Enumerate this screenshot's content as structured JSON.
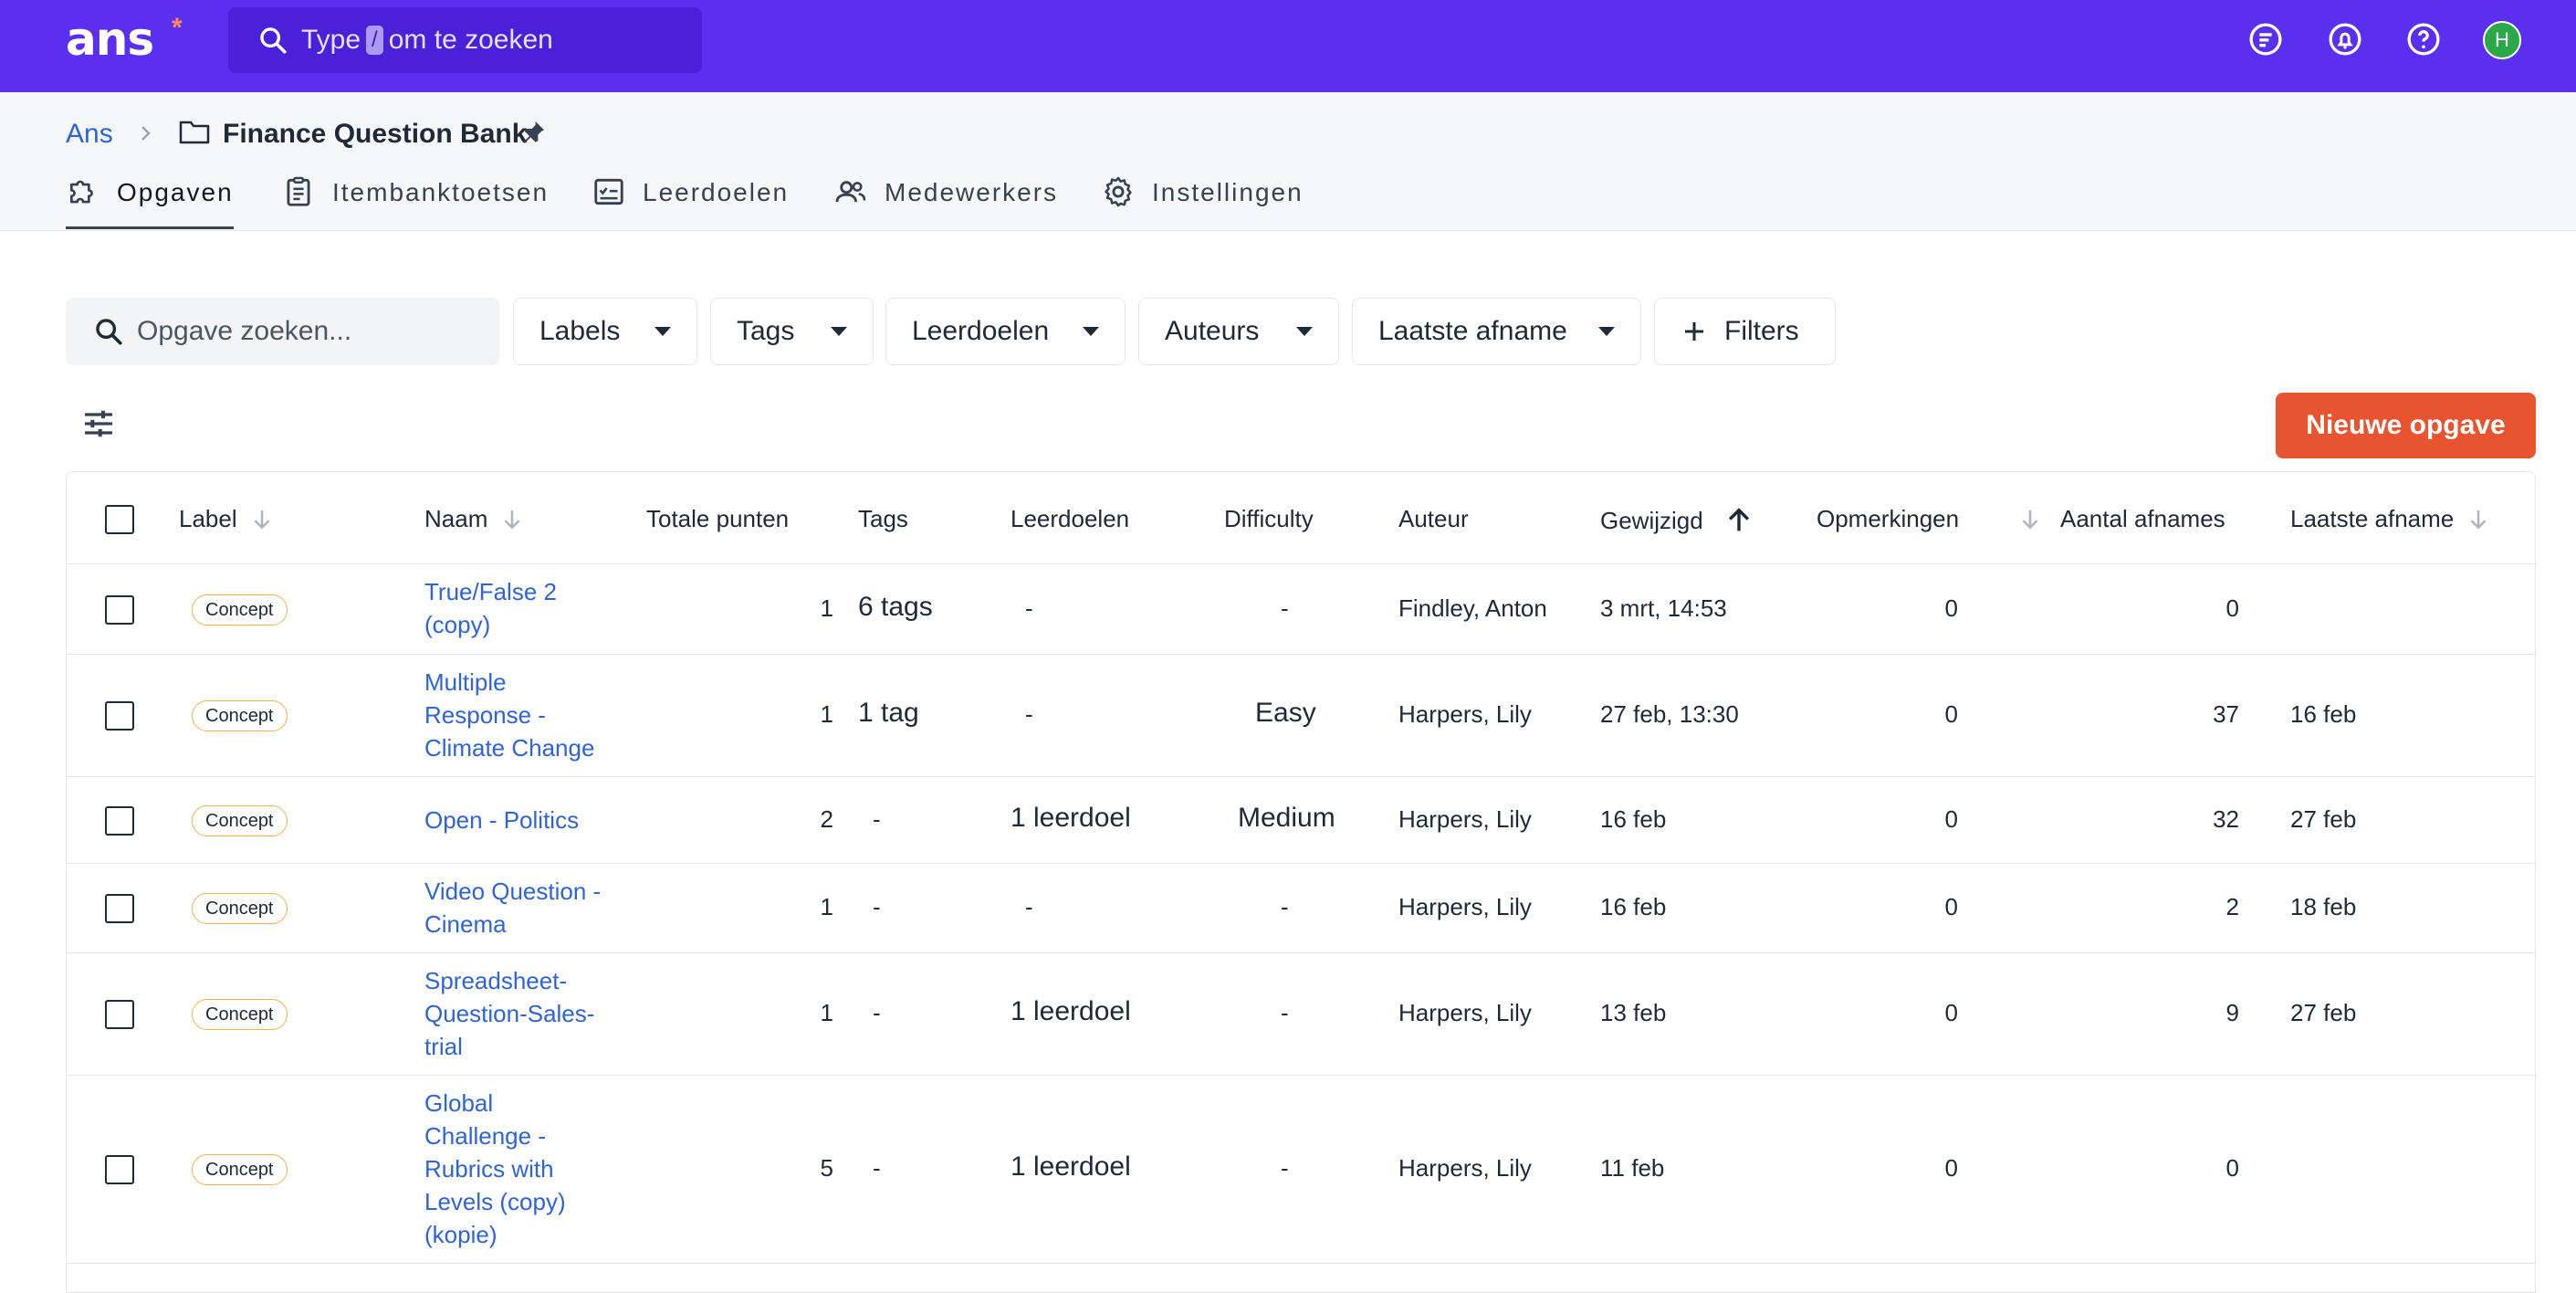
{
  "topbar": {
    "logo": "ans",
    "logo_star": "*",
    "search_pre": "Type",
    "search_key": "/",
    "search_post": "om te zoeken",
    "avatar_initial": "H",
    "icons": [
      "updates-icon",
      "notifications-icon",
      "help-icon"
    ]
  },
  "breadcrumb": {
    "root": "Ans",
    "title": "Finance Question Bank"
  },
  "tabs": [
    {
      "label": "Opgaven",
      "icon": "puzzle-icon",
      "active": true
    },
    {
      "label": "Itembanktoetsen",
      "icon": "clipboard-icon",
      "active": false
    },
    {
      "label": "Leerdoelen",
      "icon": "checklist-icon",
      "active": false
    },
    {
      "label": "Medewerkers",
      "icon": "users-icon",
      "active": false
    },
    {
      "label": "Instellingen",
      "icon": "gear-icon",
      "active": false
    }
  ],
  "filters": {
    "search_placeholder": "Opgave zoeken...",
    "labels": "Labels",
    "tags": "Tags",
    "leerdoelen": "Leerdoelen",
    "auteurs": "Auteurs",
    "laatste_afname": "Laatste afname",
    "more_filters": "Filters"
  },
  "new_button": "Nieuwe opgave",
  "table": {
    "headers": {
      "label": "Label",
      "naam": "Naam",
      "totale_punten": "Totale punten",
      "tags": "Tags",
      "leerdoelen": "Leerdoelen",
      "difficulty": "Difficulty",
      "auteur": "Auteur",
      "gewijzigd": "Gewijzigd",
      "opmerkingen": "Opmerkingen",
      "aantal_afnames": "Aantal afnames",
      "laatste_afname": "Laatste afname"
    },
    "rows": [
      {
        "label": "Concept",
        "naam": "True/False 2 (copy)",
        "punten": "1",
        "tags": "6 tags",
        "leerdoelen": "-",
        "difficulty": "-",
        "auteur": "Findley, Anton",
        "gewijzigd": "3 mrt, 14:53",
        "opmerkingen": "0",
        "afnames": "0",
        "laatste": ""
      },
      {
        "label": "Concept",
        "naam": "Multiple Response - Climate Change",
        "punten": "1",
        "tags": "1 tag",
        "leerdoelen": "-",
        "difficulty": "Easy",
        "auteur": "Harpers, Lily",
        "gewijzigd": "27 feb, 13:30",
        "opmerkingen": "0",
        "afnames": "37",
        "laatste": "16 feb"
      },
      {
        "label": "Concept",
        "naam": "Open - Politics",
        "punten": "2",
        "tags": "-",
        "leerdoelen": "1 leerdoel",
        "difficulty": "Medium",
        "auteur": "Harpers, Lily",
        "gewijzigd": "16 feb",
        "opmerkingen": "0",
        "afnames": "32",
        "laatste": "27 feb"
      },
      {
        "label": "Concept",
        "naam": "Video Question - Cinema",
        "punten": "1",
        "tags": "-",
        "leerdoelen": "-",
        "difficulty": "-",
        "auteur": "Harpers, Lily",
        "gewijzigd": "16 feb",
        "opmerkingen": "0",
        "afnames": "2",
        "laatste": "18 feb"
      },
      {
        "label": "Concept",
        "naam": "Spreadsheet-Question-Sales-trial",
        "punten": "1",
        "tags": "-",
        "leerdoelen": "1 leerdoel",
        "difficulty": "-",
        "auteur": "Harpers, Lily",
        "gewijzigd": "13 feb",
        "opmerkingen": "0",
        "afnames": "9",
        "laatste": "27 feb"
      },
      {
        "label": "Concept",
        "naam": "Global Challenge - Rubrics with Levels (copy) (kopie)",
        "punten": "5",
        "tags": "-",
        "leerdoelen": "1 leerdoel",
        "difficulty": "-",
        "auteur": "Harpers, Lily",
        "gewijzigd": "11 feb",
        "opmerkingen": "0",
        "afnames": "0",
        "laatste": ""
      }
    ]
  }
}
